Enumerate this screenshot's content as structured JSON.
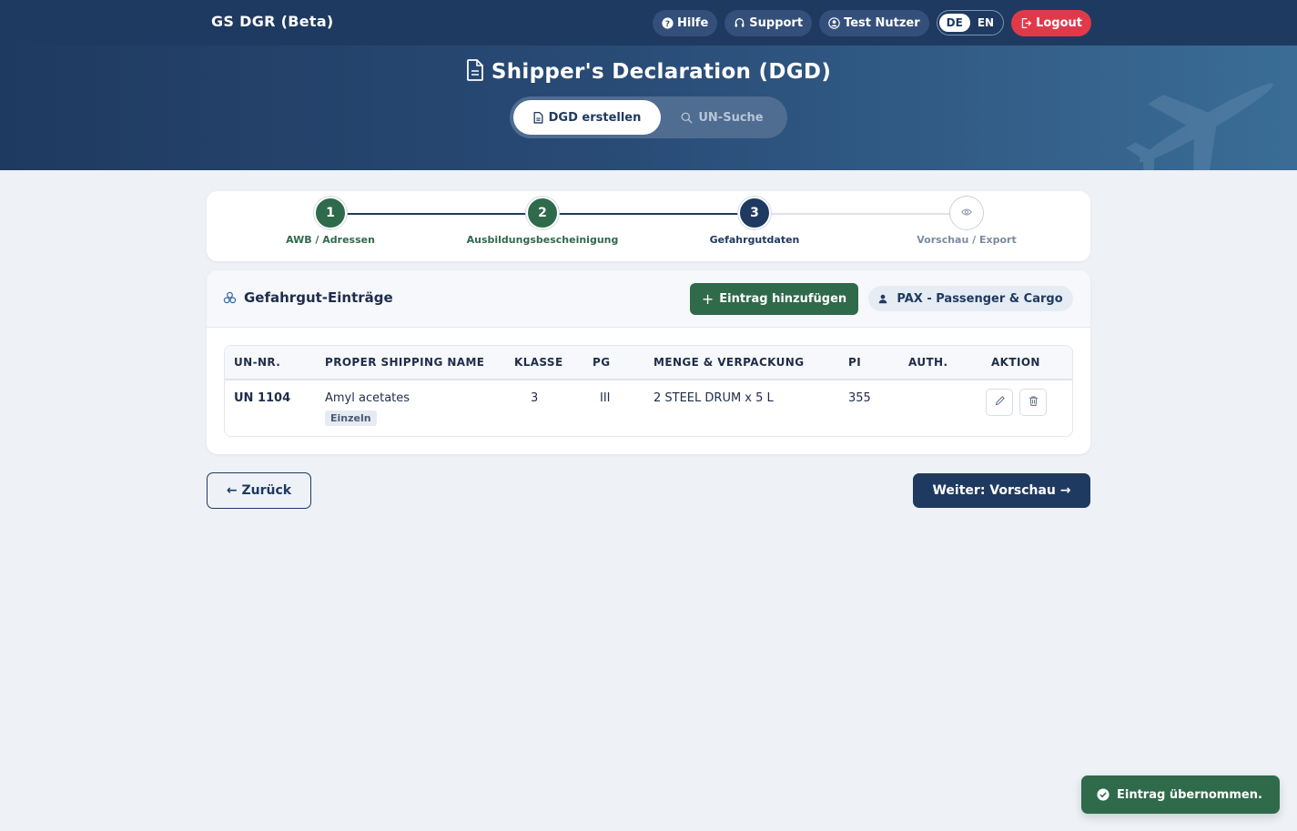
{
  "app": {
    "brand": "GS DGR (Beta)"
  },
  "navbar": {
    "help": "Hilfe",
    "support": "Support",
    "user": "Test Nutzer",
    "lang_de": "DE",
    "lang_en": "EN",
    "logout": "Logout"
  },
  "hero": {
    "title": "Shipper's Declaration (DGD)",
    "tab_create": "DGD erstellen",
    "tab_search": "UN-Suche"
  },
  "stepper": {
    "steps": [
      {
        "number": "1",
        "label": "AWB / Adressen",
        "state": "done"
      },
      {
        "number": "2",
        "label": "Ausbildungsbescheinigung",
        "state": "done"
      },
      {
        "number": "3",
        "label": "Gefahrgutdaten",
        "state": "current"
      },
      {
        "number": "",
        "label": "Vorschau / Export",
        "state": "todo"
      }
    ]
  },
  "entries": {
    "title": "Gefahrgut-Einträge",
    "add_button": "Eintrag hinzufügen",
    "mode_badge": "PAX - Passenger & Cargo",
    "columns": [
      "UN-NR.",
      "PROPER SHIPPING NAME",
      "KLASSE",
      "PG",
      "MENGE & VERPACKUNG",
      "PI",
      "AUTH.",
      "AKTION"
    ],
    "rows": [
      {
        "un": "UN 1104",
        "name": "Amyl acetates",
        "tag": "Einzeln",
        "klasse": "3",
        "pg": "III",
        "menge": "2 STEEL DRUM x 5 L",
        "pi": "355",
        "auth": ""
      }
    ]
  },
  "footer": {
    "back": "← Zurück",
    "next": "Weiter: Vorschau →"
  },
  "toast": {
    "message": "Eintrag übernommen."
  },
  "colors": {
    "navy": "#1f3a60",
    "green": "#2f6a4b",
    "red": "#e03a4a",
    "background": "#eef1f6"
  },
  "icons": {
    "help": "question-circle-icon",
    "support": "headset-icon",
    "user": "user-circle-icon",
    "logout": "logout-icon",
    "title": "document-icon",
    "search": "search-icon",
    "entries": "hazard-icon",
    "pax": "person-icon",
    "edit": "pencil-icon",
    "delete": "trash-icon",
    "preview": "eye-icon",
    "toast": "check-circle-icon"
  }
}
